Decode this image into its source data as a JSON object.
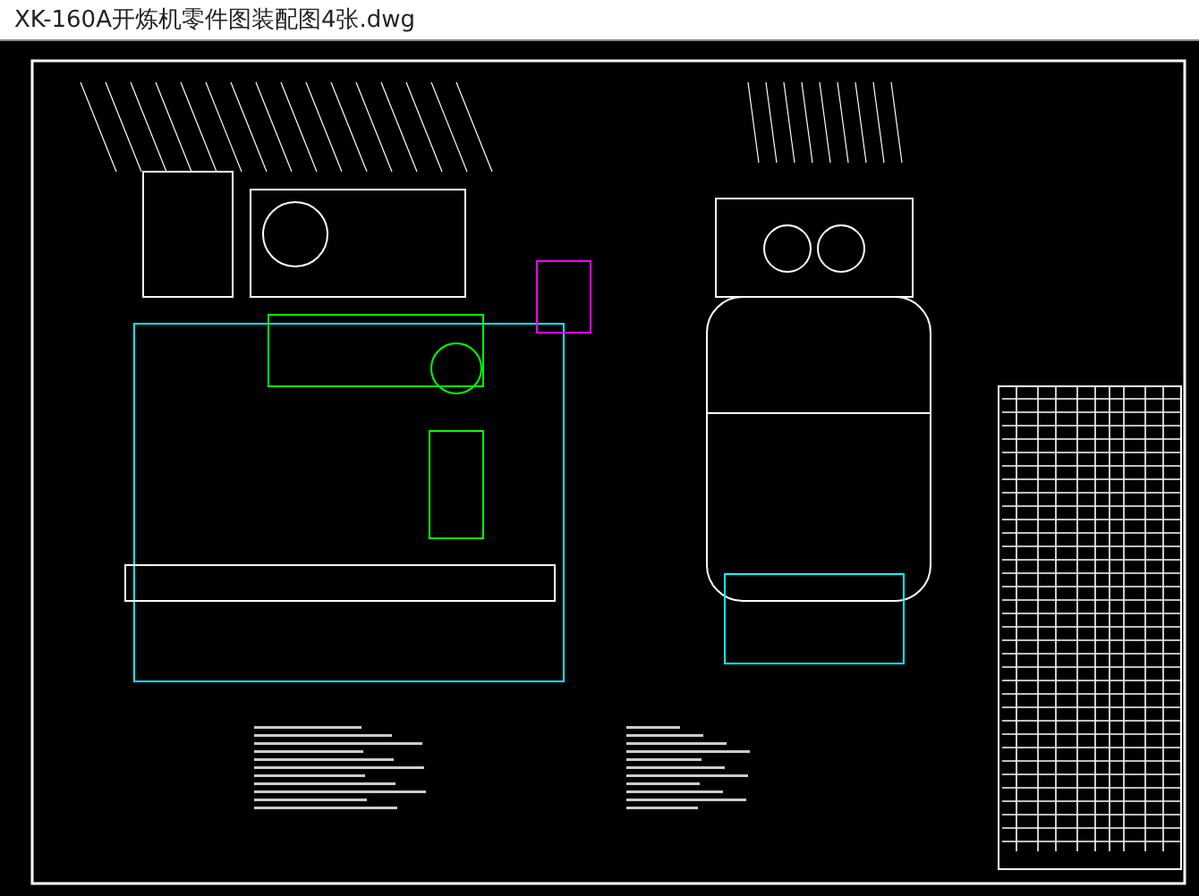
{
  "window": {
    "title": "XK-160A开炼机零件图装配图4张.dwg"
  }
}
